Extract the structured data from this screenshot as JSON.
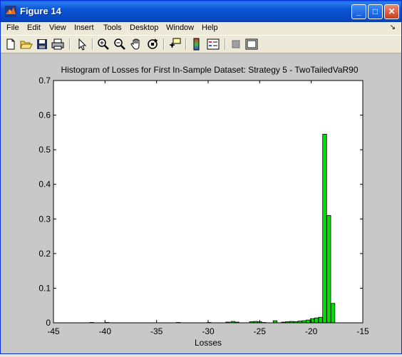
{
  "window": {
    "title": "Figure 14",
    "minimize_label": "_",
    "maximize_label": "□",
    "close_label": "✕"
  },
  "menu": {
    "items": [
      "File",
      "Edit",
      "View",
      "Insert",
      "Tools",
      "Desktop",
      "Window",
      "Help"
    ],
    "dock_arrow": "↘"
  },
  "toolbar": {
    "icons": [
      "new-figure-icon",
      "open-file-icon",
      "save-icon",
      "print-icon",
      "pointer-icon",
      "zoom-in-icon",
      "zoom-out-icon",
      "pan-hand-icon",
      "rotate-3d-icon",
      "data-cursor-icon",
      "colorbar-icon",
      "legend-icon",
      "hide-plot-tools-icon",
      "show-plot-tools-icon"
    ]
  },
  "colors": {
    "bar_fill": "#00e000",
    "bar_edge": "#000000",
    "axes_bg": "#ffffff",
    "figure_bg": "#c8c8c8"
  },
  "chart_data": {
    "type": "bar",
    "title": "Histogram of Losses for First In-Sample Dataset: Strategy 5 - TwoTailedVaR90",
    "xlabel": "Losses",
    "ylabel": "",
    "xlim": [
      -45,
      -15
    ],
    "ylim": [
      0,
      0.7
    ],
    "xticks": [
      "-45",
      "-40",
      "-35",
      "-30",
      "-25",
      "-20",
      "-15"
    ],
    "yticks": [
      "0",
      "0.1",
      "0.2",
      "0.3",
      "0.4",
      "0.5",
      "0.6",
      "0.7"
    ],
    "x": [
      -41.3,
      -39.8,
      -32.9,
      -29.9,
      -28.1,
      -27.6,
      -27.2,
      -25.8,
      -25.4,
      -25.0,
      -24.6,
      -23.5,
      -22.7,
      -22.3,
      -21.9,
      -21.5,
      -21.1,
      -20.7,
      -20.3,
      -19.9,
      -19.5,
      -19.1,
      -18.7,
      -18.3,
      -17.9
    ],
    "values": [
      0.001,
      0.001,
      0.001,
      0.001,
      0.002,
      0.004,
      0.002,
      0.003,
      0.004,
      0.003,
      0.001,
      0.006,
      0.002,
      0.003,
      0.004,
      0.003,
      0.005,
      0.006,
      0.008,
      0.012,
      0.014,
      0.016,
      0.545,
      0.31,
      0.056
    ],
    "bar_width": 0.38,
    "grid": false
  }
}
